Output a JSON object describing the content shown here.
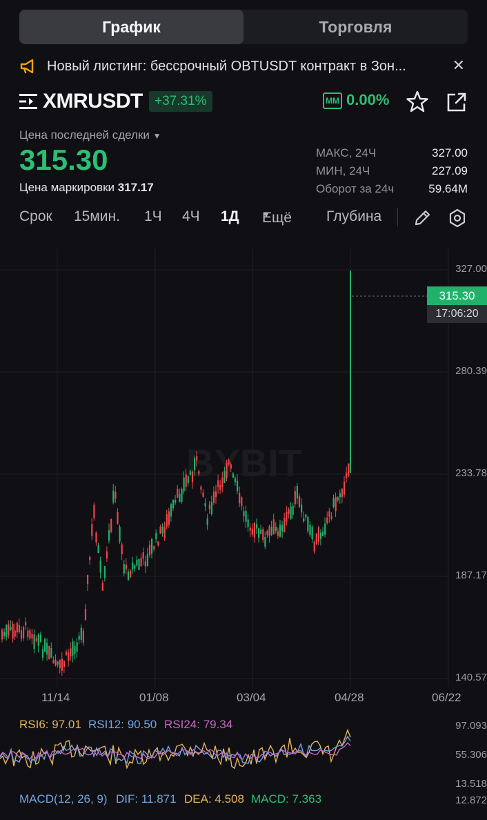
{
  "tabs": {
    "chart": "График",
    "trade": "Торговля"
  },
  "notice": {
    "text": "Новый листинг: бессрочный OBTUSDT контракт в Зон..."
  },
  "symbol": {
    "name": "XMRUSDT",
    "change": "+37.31%",
    "mm_label": "MM",
    "mm_value": "0.00%"
  },
  "price": {
    "last_label": "Цена последней сделки",
    "last_value": "315.30",
    "mark_label": "Цена маркировки",
    "mark_value": "317.17",
    "stats": [
      {
        "k": "МАКС, 24Ч",
        "v": "327.00"
      },
      {
        "k": "МИН, 24Ч",
        "v": "227.09"
      },
      {
        "k": "Оборот за 24ч",
        "v": "59.64M"
      }
    ]
  },
  "timeframes": {
    "label": "Срок",
    "m15": "15мин.",
    "h1": "1Ч",
    "h4": "4Ч",
    "d1": "1Д",
    "more": "Ещё",
    "depth": "Глубина"
  },
  "chart": {
    "y_ticks": [
      "327.00",
      "280.39",
      "233.78",
      "187.17",
      "140.57"
    ],
    "x_ticks": [
      "11/14",
      "01/08",
      "03/04",
      "04/28",
      "06/22"
    ],
    "price_tag": "315.30",
    "time_tag": "17:06:20",
    "watermark": "BYBIT",
    "up_color": "#20b26b",
    "down_color": "#ef454a"
  },
  "indicators": {
    "rsi6": "RSI6: 97.01",
    "rsi12": "RSI12: 90.50",
    "rsi24": "RSI24: 79.34",
    "rsi_ticks": [
      "97.093",
      "55.306",
      "13.518"
    ],
    "macd_label": "MACD(12, 26, 9)",
    "dif": "DIF: 11.871",
    "dea": "DEA: 4.508",
    "macd": "MACD: 7.363",
    "macd_tick": "12.872"
  }
}
